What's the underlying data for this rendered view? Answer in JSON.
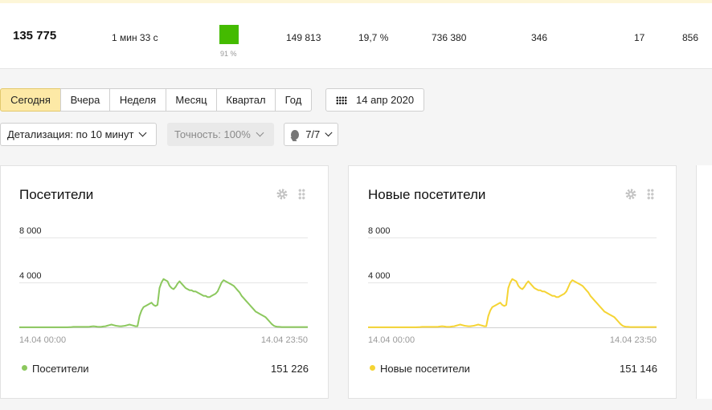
{
  "metrics": {
    "visits": "135 775",
    "avg_duration": "1 мин 33 с",
    "bounce_percent_label": "91 %",
    "bounce_color": "#44bb00",
    "pageviews": "149 813",
    "percent": "19,7 %",
    "value_a": "736 380",
    "value_b": "346",
    "value_c": "17",
    "value_d": "856"
  },
  "period_tabs": [
    {
      "label": "Сегодня",
      "active": true
    },
    {
      "label": "Вчера",
      "active": false
    },
    {
      "label": "Неделя",
      "active": false
    },
    {
      "label": "Месяц",
      "active": false
    },
    {
      "label": "Квартал",
      "active": false
    },
    {
      "label": "Год",
      "active": false
    }
  ],
  "date_picker": {
    "label": "14 апр 2020",
    "icon": "calendar-icon"
  },
  "filters": {
    "detail": "Детализация: по 10 минут",
    "accuracy": "Точность: 100%",
    "segments": "7/7"
  },
  "colors": {
    "accent_active_tab": "#fde9a6",
    "visitors_series": "#8cc85e",
    "new_visitors_series": "#f5d434"
  },
  "chart_data": [
    {
      "type": "line",
      "title": "Посетители",
      "x_labels": [
        "14.04 00:00",
        "14.04 23:50"
      ],
      "yticks": [
        "8 000",
        "4 000"
      ],
      "ylim": [
        0,
        8000
      ],
      "series": [
        {
          "name": "Посетители",
          "color": "#8cc85e",
          "total": "151 226",
          "values": [
            10,
            10,
            10,
            10,
            10,
            10,
            10,
            10,
            10,
            10,
            10,
            10,
            10,
            10,
            10,
            10,
            10,
            10,
            10,
            10,
            10,
            10,
            10,
            10,
            10,
            20,
            30,
            40,
            40,
            40,
            40,
            40,
            40,
            40,
            40,
            60,
            80,
            100,
            80,
            60,
            40,
            60,
            80,
            100,
            150,
            200,
            250,
            200,
            150,
            120,
            100,
            100,
            120,
            150,
            200,
            250,
            200,
            150,
            100,
            100,
            1000,
            1500,
            1800,
            1900,
            2000,
            2100,
            2200,
            2000,
            1900,
            2000,
            3500,
            4000,
            4300,
            4200,
            4100,
            3700,
            3500,
            3400,
            3600,
            3900,
            4100,
            3900,
            3700,
            3500,
            3400,
            3300,
            3300,
            3200,
            3200,
            3100,
            3000,
            2900,
            2800,
            2800,
            2700,
            2700,
            2800,
            2900,
            3000,
            3200,
            3600,
            4000,
            4200,
            4100,
            4000,
            3900,
            3800,
            3700,
            3500,
            3300,
            3100,
            2800,
            2600,
            2400,
            2200,
            2000,
            1800,
            1600,
            1400,
            1300,
            1200,
            1100,
            1000,
            900,
            700,
            500,
            300,
            150,
            80,
            50,
            40,
            30,
            30,
            30,
            30,
            30,
            30,
            30,
            30,
            30,
            30,
            30,
            30,
            30,
            30
          ]
        }
      ]
    },
    {
      "type": "line",
      "title": "Новые посетители",
      "x_labels": [
        "14.04 00:00",
        "14.04 23:50"
      ],
      "yticks": [
        "8 000",
        "4 000"
      ],
      "ylim": [
        0,
        8000
      ],
      "series": [
        {
          "name": "Новые посетители",
          "color": "#f5d434",
          "total": "151 146",
          "values": [
            10,
            10,
            10,
            10,
            10,
            10,
            10,
            10,
            10,
            10,
            10,
            10,
            10,
            10,
            10,
            10,
            10,
            10,
            10,
            10,
            10,
            10,
            10,
            10,
            10,
            20,
            30,
            40,
            40,
            40,
            40,
            40,
            40,
            40,
            40,
            60,
            80,
            100,
            80,
            60,
            40,
            60,
            80,
            100,
            150,
            200,
            250,
            200,
            150,
            120,
            100,
            100,
            120,
            150,
            200,
            250,
            200,
            150,
            100,
            100,
            1000,
            1500,
            1800,
            1900,
            2000,
            2100,
            2200,
            2000,
            1900,
            2000,
            3500,
            4000,
            4300,
            4200,
            4100,
            3700,
            3500,
            3400,
            3600,
            3900,
            4100,
            3900,
            3700,
            3500,
            3400,
            3300,
            3300,
            3200,
            3200,
            3100,
            3000,
            2900,
            2800,
            2800,
            2700,
            2700,
            2800,
            2900,
            3000,
            3200,
            3600,
            4000,
            4200,
            4100,
            4000,
            3900,
            3800,
            3700,
            3500,
            3300,
            3100,
            2800,
            2600,
            2400,
            2200,
            2000,
            1800,
            1600,
            1400,
            1300,
            1200,
            1100,
            1000,
            900,
            700,
            500,
            300,
            150,
            80,
            50,
            40,
            30,
            30,
            30,
            30,
            30,
            30,
            30,
            30,
            30,
            30,
            30,
            30,
            30,
            30
          ]
        }
      ]
    }
  ]
}
